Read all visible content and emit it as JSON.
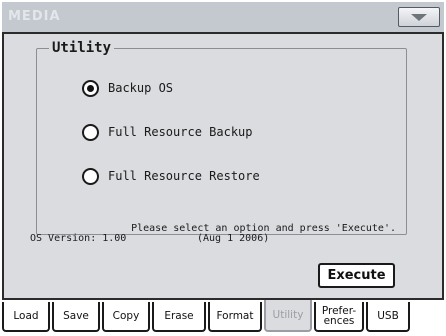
{
  "window": {
    "title": "MEDIA"
  },
  "utility": {
    "legend": "Utility",
    "options": [
      {
        "label": "Backup OS",
        "selected": true
      },
      {
        "label": "Full Resource Backup",
        "selected": false
      },
      {
        "label": "Full Resource Restore",
        "selected": false
      }
    ],
    "hint": "Please select an option and press 'Execute'."
  },
  "footer": {
    "os_version": "OS Version: 1.00",
    "os_date": "(Aug  1 2006)",
    "execute_label": "Execute"
  },
  "tabs": [
    {
      "label": "Load",
      "active": false
    },
    {
      "label": "Save",
      "active": false
    },
    {
      "label": "Copy",
      "active": false
    },
    {
      "label": "Erase",
      "active": false
    },
    {
      "label": "Format",
      "active": false
    },
    {
      "label": "Utility",
      "active": true
    },
    {
      "label": "Prefer-\nences",
      "active": false
    },
    {
      "label": "USB",
      "active": false
    }
  ],
  "colors": {
    "panel": "#dadcdf",
    "titlebar": "#c4c8cf",
    "border": "#1a1a1a",
    "inactive_text": "#9a9ea4"
  }
}
